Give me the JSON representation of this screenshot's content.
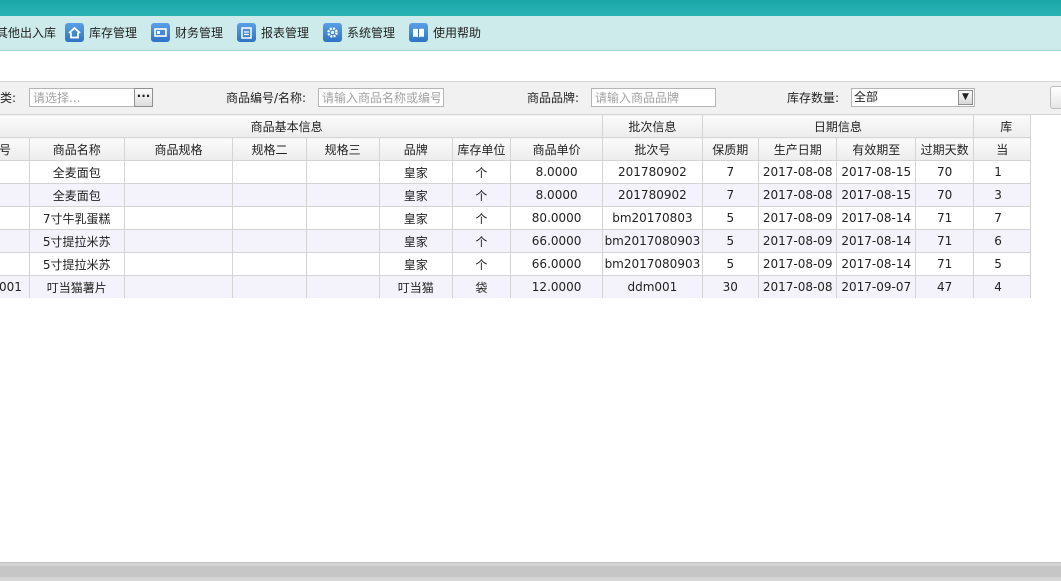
{
  "menu": [
    {
      "label": "其他出入库",
      "icon": "none"
    },
    {
      "label": "库存管理",
      "icon": "home-icon"
    },
    {
      "label": "财务管理",
      "icon": "finance-icon"
    },
    {
      "label": "报表管理",
      "icon": "calendar-report-icon"
    },
    {
      "label": "系统管理",
      "icon": "gear-icon"
    },
    {
      "label": "使用帮助",
      "icon": "book-icon"
    }
  ],
  "filters": {
    "category_label": "类:",
    "category_placeholder": "请选择...",
    "picker_button": "···",
    "code_label": "商品编号/名称:",
    "code_placeholder": "请输入商品名称或编号",
    "brand_label": "商品品牌:",
    "brand_placeholder": "请输入商品品牌",
    "qty_label": "库存数量:",
    "qty_value": "全部"
  },
  "table": {
    "groups": {
      "basic": "商品基本信息",
      "batch": "批次信息",
      "date": "日期信息",
      "extra": "库"
    },
    "columns": [
      "号",
      "商品名称",
      "商品规格",
      "规格二",
      "规格三",
      "品牌",
      "库存单位",
      "商品单价",
      "批次号",
      "保质期",
      "生产日期",
      "有效期至",
      "过期天数",
      "当"
    ],
    "rows": [
      [
        "",
        "全麦面包",
        "",
        "",
        "",
        "皇家",
        "个",
        "8.0000",
        "201780902",
        "7",
        "2017-08-08",
        "2017-08-15",
        "70",
        "1"
      ],
      [
        "",
        "全麦面包",
        "",
        "",
        "",
        "皇家",
        "个",
        "8.0000",
        "201780902",
        "7",
        "2017-08-08",
        "2017-08-15",
        "70",
        "3"
      ],
      [
        "",
        "7寸牛乳蛋糕",
        "",
        "",
        "",
        "皇家",
        "个",
        "80.0000",
        "bm20170803",
        "5",
        "2017-08-09",
        "2017-08-14",
        "71",
        "7"
      ],
      [
        "",
        "5寸提拉米苏",
        "",
        "",
        "",
        "皇家",
        "个",
        "66.0000",
        "bm2017080903",
        "5",
        "2017-08-09",
        "2017-08-14",
        "71",
        "6"
      ],
      [
        "",
        "5寸提拉米苏",
        "",
        "",
        "",
        "皇家",
        "个",
        "66.0000",
        "bm2017080903",
        "5",
        "2017-08-09",
        "2017-08-14",
        "71",
        "5"
      ],
      [
        "001",
        "叮当猫薯片",
        "",
        "",
        "",
        "叮当猫",
        "袋",
        "12.0000",
        "ddm001",
        "30",
        "2017-08-08",
        "2017-09-07",
        "47",
        "4"
      ]
    ]
  },
  "colors": {
    "topbar": "#1aa6a8",
    "menubar": "#cdebeb",
    "alt_row": "#f4f3fb"
  }
}
